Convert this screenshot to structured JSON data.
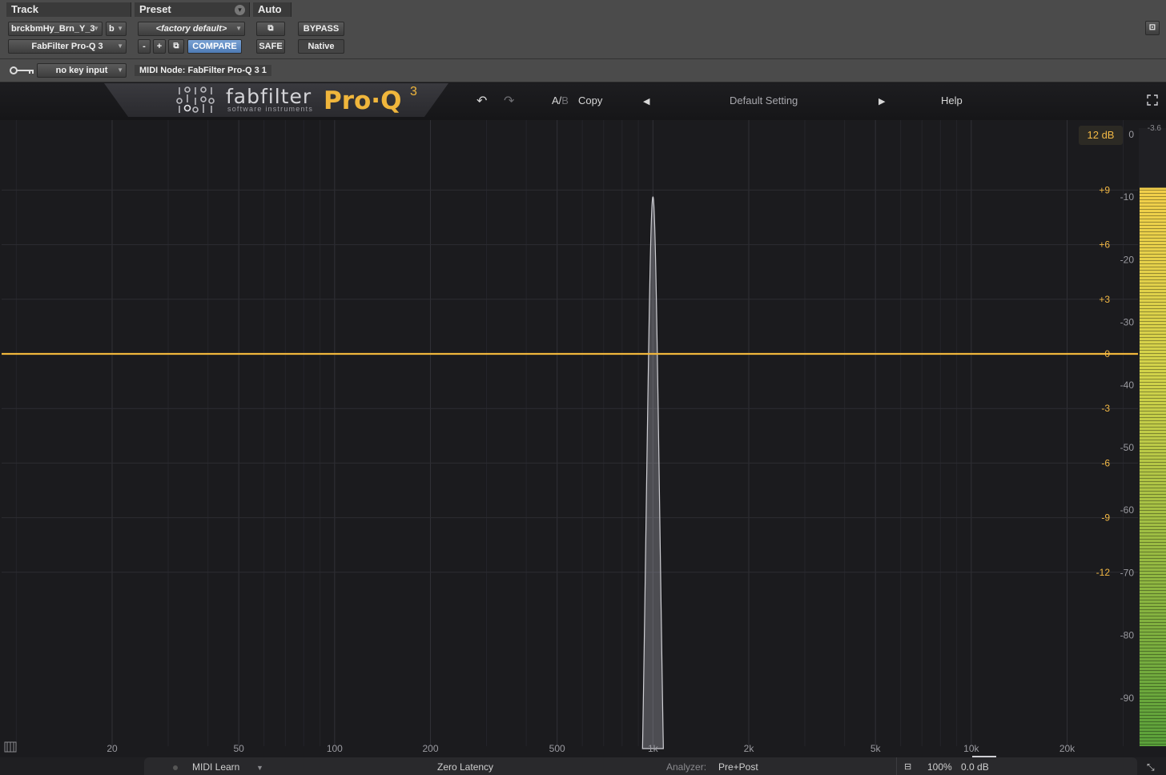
{
  "host": {
    "track_label": "Track",
    "preset_label": "Preset",
    "auto_label": "Auto",
    "track_name": "brckbmHy_Brn_Y_3",
    "track_channel": "b",
    "plugin_name": "FabFilter Pro-Q 3",
    "preset_name": "<factory default>",
    "minus_label": "-",
    "plus_label": "+",
    "compare_label": "COMPARE",
    "safe_label": "SAFE",
    "bypass_label": "BYPASS",
    "native_label": "Native",
    "key_input": "no key input",
    "midi_node": "MIDI Node: FabFilter Pro-Q 3 1"
  },
  "plugin": {
    "logo_text": "fabfilter",
    "logo_subtext": "software instruments",
    "product_name": "Pro·Q",
    "product_version": "3",
    "ab_a": "A/",
    "ab_b": "B",
    "copy_label": "Copy",
    "preset_name": "Default Setting",
    "help_label": "Help"
  },
  "graph": {
    "range_label": "12 dB",
    "meter_peak": "-3.6",
    "meter_level_dbfs": -8.5,
    "eq_scale_labels": [
      "+9",
      "+6",
      "+3",
      "0",
      "-3",
      "-6",
      "-9",
      "-12"
    ],
    "analyzer_scale_labels": [
      "0",
      "-10",
      "-20",
      "-30",
      "-40",
      "-50",
      "-60",
      "-70",
      "-80",
      "-90"
    ],
    "freq_labels": [
      "20",
      "50",
      "100",
      "200",
      "500",
      "1k",
      "2k",
      "5k",
      "10k",
      "20k"
    ],
    "response_gain_db": 0,
    "spectrum_peak_hz": 1000,
    "colors": {
      "eq_curve": "#f0b63c",
      "eq_scale": "#f2b845",
      "analyzer_scale": "#9a9aa0",
      "spectrum": "#cfcfd4",
      "meter": "#c8d24a"
    }
  },
  "bottom": {
    "midi_learn": "MIDI Learn",
    "latency": "Zero Latency",
    "analyzer_label": "Analyzer:",
    "analyzer_value": "Pre+Post",
    "zoom": "100%",
    "output_gain": "0.0 dB"
  }
}
